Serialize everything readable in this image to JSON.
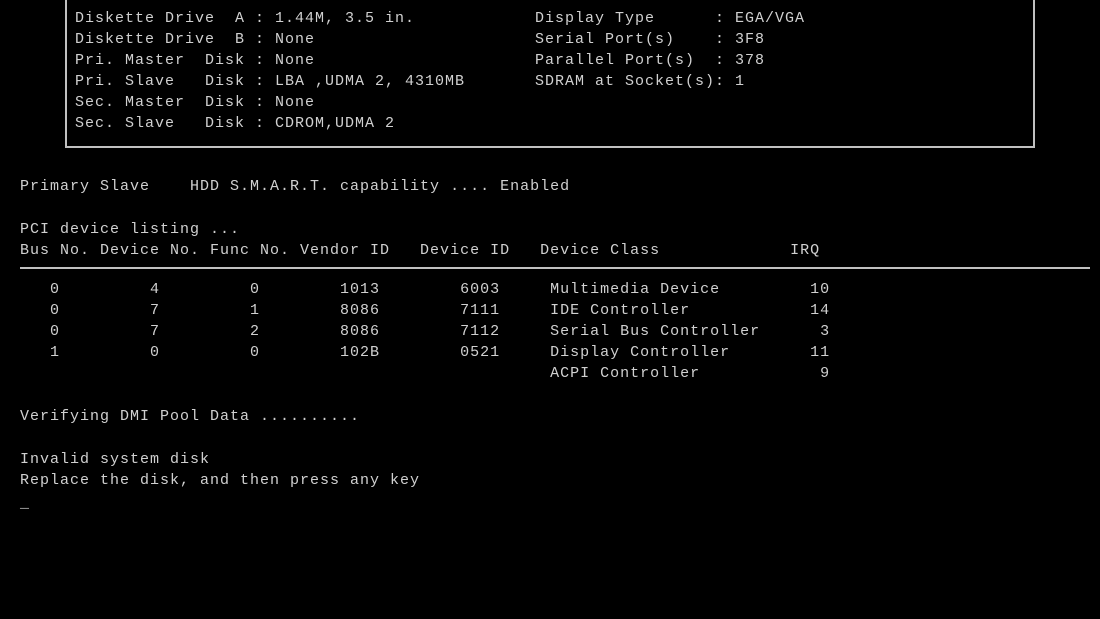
{
  "sysinfo": {
    "rows": [
      {
        "left": "Diskette Drive  A : 1.44M, 3.5 in.",
        "right": "Display Type      : EGA/VGA"
      },
      {
        "left": "Diskette Drive  B : None",
        "right": "Serial Port(s)    : 3F8"
      },
      {
        "left": "Pri. Master  Disk : None",
        "right": "Parallel Port(s)  : 378"
      },
      {
        "left": "Pri. Slave   Disk : LBA ,UDMA 2, 4310MB",
        "right": "SDRAM at Socket(s): 1"
      },
      {
        "left": "Sec. Master  Disk : None",
        "right": ""
      },
      {
        "left": "Sec. Slave   Disk : CDROM,UDMA 2",
        "right": ""
      }
    ]
  },
  "smart": "Primary Slave    HDD S.M.A.R.T. capability .... Enabled",
  "pci": {
    "title": "PCI device listing ...",
    "header": "Bus No. Device No. Func No. Vendor ID   Device ID   Device Class             IRQ",
    "rows": [
      "   0         4         0        1013        6003     Multimedia Device         10",
      "   0         7         1        8086        7111     IDE Controller            14",
      "   0         7         2        8086        7112     Serial Bus Controller      3",
      "   1         0         0        102B        0521     Display Controller        11",
      "                                                     ACPI Controller            9"
    ]
  },
  "dmi": "Verifying DMI Pool Data ..........",
  "error": {
    "line1": "Invalid system disk",
    "line2": "Replace the disk, and then press any key"
  },
  "cursor": "_"
}
